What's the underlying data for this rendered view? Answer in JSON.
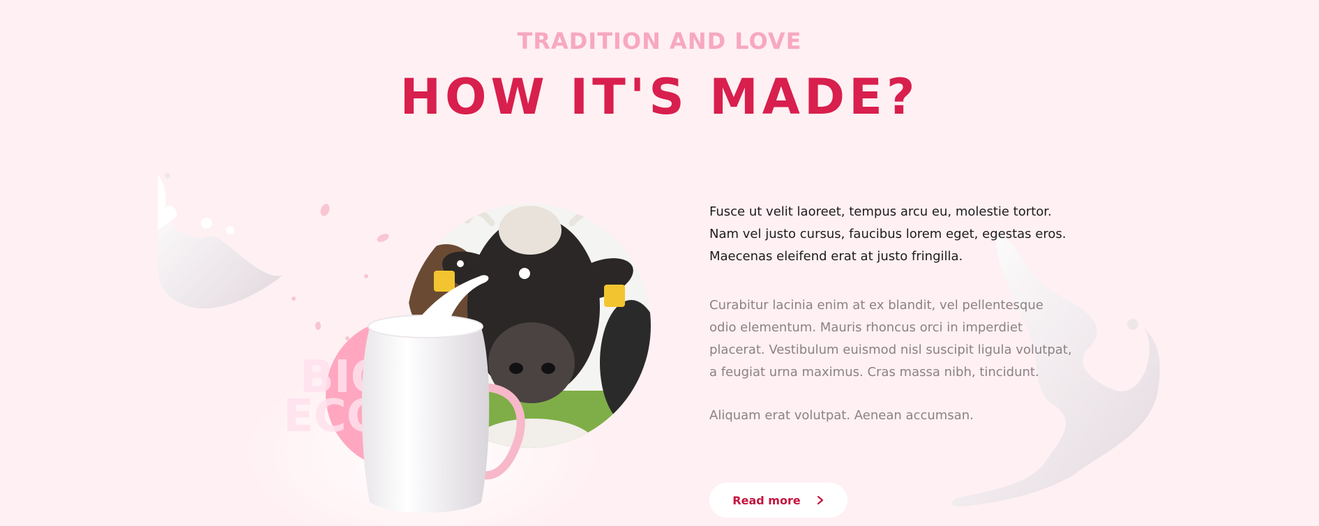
{
  "header": {
    "eyebrow": "TRADITION AND LOVE",
    "title": "HOW IT'S MADE?"
  },
  "badge": {
    "line1": "BIO",
    "line2": "ECO"
  },
  "content": {
    "lead": "Fusce ut velit laoreet, tempus arcu eu, molestie tortor. Nam vel justo cursus, faucibus lorem eget, egestas eros. Maecenas eleifend erat at justo fringilla.",
    "body": "Curabitur lacinia enim at ex blandit, vel pellentesque odio elementum. Mauris rhoncus orci in imperdiet placerat. Vestibulum euismod nisl suscipit ligula volutpat, a feugiat urna maximus. Cras massa nibh, tincidunt.",
    "body2": "Aliquam erat volutpat. Aenean accumsan.",
    "button_label": "Read more"
  },
  "icons": {
    "button_icon": "chevron-right-icon"
  },
  "colors": {
    "background": "#fff0f3",
    "eyebrow": "#f7a8c0",
    "title": "#d81f4d",
    "accent_circle": "#ffa7c0",
    "button_text": "#c4143e"
  }
}
